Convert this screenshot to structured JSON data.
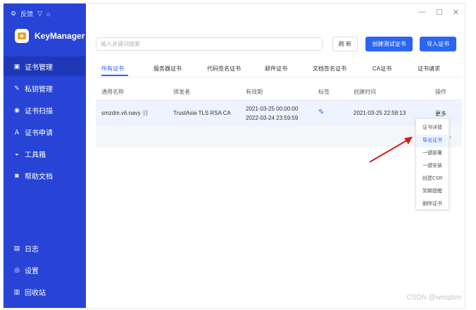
{
  "titlebar": {
    "icons": [
      {
        "name": "gear-icon",
        "glyph": "⚙"
      },
      {
        "name": "feedback-label",
        "text": "反馈"
      },
      {
        "name": "shield-icon",
        "glyph": "▽"
      },
      {
        "name": "lock-icon",
        "glyph": "⌂"
      }
    ],
    "window_controls": {
      "minimize": "—",
      "maximize": "☐",
      "close": "✕"
    }
  },
  "brand": {
    "name": "KeyManager"
  },
  "sidebar": {
    "items": [
      {
        "label": "证书管理",
        "icon": "cert-icon",
        "glyph": "▣",
        "active": true
      },
      {
        "label": "私钥管理",
        "icon": "key-icon",
        "glyph": "✎",
        "active": false
      },
      {
        "label": "证书扫描",
        "icon": "scan-icon",
        "glyph": "◉",
        "active": false
      },
      {
        "label": "证书申请",
        "icon": "user-icon",
        "glyph": "Ａ",
        "active": false
      },
      {
        "label": "工具箱",
        "icon": "toolbox-icon",
        "glyph": "◒",
        "active": false
      },
      {
        "label": "帮助文档",
        "icon": "help-icon",
        "glyph": "◙",
        "active": false
      }
    ],
    "bottom_items": [
      {
        "label": "日志",
        "icon": "log-icon",
        "glyph": "▤"
      },
      {
        "label": "设置",
        "icon": "settings-icon",
        "glyph": "◎"
      },
      {
        "label": "回收站",
        "icon": "trash-icon",
        "glyph": "▥"
      }
    ]
  },
  "toolbar": {
    "search_placeholder": "输入关键词搜索",
    "refresh_label": "刷 新",
    "create_test_label": "创建测试证书",
    "import_label": "导入证书"
  },
  "tabs": [
    "所有证书",
    "服务器证书",
    "代码签名证书",
    "邮件证书",
    "文档签名证书",
    "CA证书",
    "证书请求"
  ],
  "table": {
    "headers": [
      "通用名称",
      "颁发者",
      "有效期",
      "标签",
      "创建时间",
      "操作"
    ],
    "rows": [
      {
        "common_name": "smzdm.v6.navy",
        "issuer": "TrustAsia TLS RSA CA",
        "valid_from": "2021-03-25 00:00:00",
        "valid_to": "2022-03-24 23:59:59",
        "created": "2021-03-25 22:58:13",
        "action": "更多"
      }
    ]
  },
  "context_menu": {
    "items": [
      "证书详情",
      "导出证书",
      "一键部署",
      "一键安装",
      "创建CSR",
      "到期提醒",
      "删除证书"
    ],
    "highlighted": 1
  },
  "colors": {
    "sidebar": "#2744d6",
    "sidebar_active": "#1f38b8",
    "accent": "#2a66f0",
    "arrow": "#d21f1f"
  },
  "watermark": "CSDN @wespten"
}
